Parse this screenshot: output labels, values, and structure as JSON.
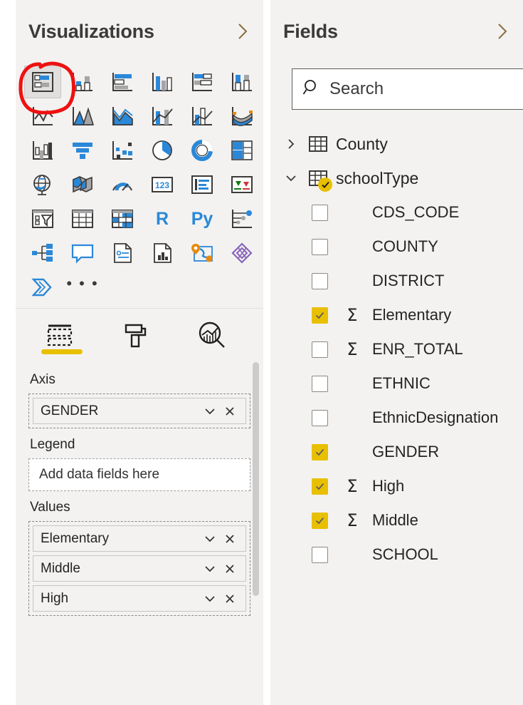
{
  "visualizations": {
    "title": "Visualizations",
    "collapse_icon": "chevron-right-icon",
    "icons": [
      {
        "name": "stacked-bar-chart-icon",
        "selected": true
      },
      {
        "name": "stacked-column-chart-icon",
        "selected": false
      },
      {
        "name": "clustered-bar-chart-icon",
        "selected": false
      },
      {
        "name": "clustered-column-chart-icon",
        "selected": false
      },
      {
        "name": "100-percent-stacked-bar-chart-icon",
        "selected": false
      },
      {
        "name": "100-percent-stacked-column-chart-icon",
        "selected": false
      },
      {
        "name": "line-chart-icon",
        "selected": false
      },
      {
        "name": "area-chart-icon",
        "selected": false
      },
      {
        "name": "stacked-area-chart-icon",
        "selected": false
      },
      {
        "name": "line-and-stacked-column-chart-icon",
        "selected": false
      },
      {
        "name": "line-and-clustered-column-chart-icon",
        "selected": false
      },
      {
        "name": "ribbon-chart-icon",
        "selected": false
      },
      {
        "name": "waterfall-chart-icon",
        "selected": false
      },
      {
        "name": "funnel-chart-icon",
        "selected": false
      },
      {
        "name": "scatter-chart-icon",
        "selected": false
      },
      {
        "name": "pie-chart-icon",
        "selected": false
      },
      {
        "name": "donut-chart-icon",
        "selected": false
      },
      {
        "name": "treemap-icon",
        "selected": false
      },
      {
        "name": "map-icon",
        "selected": false
      },
      {
        "name": "filled-map-icon",
        "selected": false
      },
      {
        "name": "gauge-icon",
        "selected": false
      },
      {
        "name": "card-icon",
        "selected": false
      },
      {
        "name": "multi-row-card-icon",
        "selected": false
      },
      {
        "name": "kpi-icon",
        "selected": false
      },
      {
        "name": "slicer-icon",
        "selected": false
      },
      {
        "name": "table-icon",
        "selected": false
      },
      {
        "name": "matrix-icon",
        "selected": false
      },
      {
        "name": "r-script-visual-icon",
        "selected": false,
        "text": "R"
      },
      {
        "name": "python-visual-icon",
        "selected": false,
        "text": "Py"
      },
      {
        "name": "key-influencers-icon",
        "selected": false
      },
      {
        "name": "decomposition-tree-icon",
        "selected": false
      },
      {
        "name": "q-and-a-icon",
        "selected": false
      },
      {
        "name": "smart-narrative-icon",
        "selected": false
      },
      {
        "name": "paginated-report-icon",
        "selected": false
      },
      {
        "name": "arcgis-maps-icon",
        "selected": false
      },
      {
        "name": "power-apps-icon",
        "selected": false
      },
      {
        "name": "power-automate-icon",
        "selected": false
      },
      {
        "name": "more-options-icon",
        "selected": false,
        "text": "• • •"
      }
    ],
    "tabs": [
      {
        "name": "tab-fields",
        "icon": "fields-dashed-table-icon",
        "active": true
      },
      {
        "name": "tab-format",
        "icon": "paint-roller-icon",
        "active": false
      },
      {
        "name": "tab-analytics",
        "icon": "analytics-magnifier-icon",
        "active": false
      }
    ],
    "wells": [
      {
        "label": "Axis",
        "empty": false,
        "fields": [
          {
            "name": "GENDER",
            "dropdown_icon": "chevron-down-icon",
            "remove_icon": "close-icon"
          }
        ]
      },
      {
        "label": "Legend",
        "empty": true,
        "placeholder": "Add data fields here",
        "fields": []
      },
      {
        "label": "Values",
        "empty": false,
        "fields": [
          {
            "name": "Elementary",
            "dropdown_icon": "chevron-down-icon",
            "remove_icon": "close-icon"
          },
          {
            "name": "Middle",
            "dropdown_icon": "chevron-down-icon",
            "remove_icon": "close-icon"
          },
          {
            "name": "High",
            "dropdown_icon": "chevron-down-icon",
            "remove_icon": "close-icon"
          }
        ]
      }
    ]
  },
  "fields": {
    "title": "Fields",
    "collapse_icon": "chevron-right-icon",
    "search": {
      "value": "",
      "placeholder": "Search",
      "icon": "search-icon"
    },
    "tables": [
      {
        "name": "County",
        "expanded": false,
        "expander_icon": "chevron-right-icon",
        "table_icon": "table-icon",
        "badge": false,
        "columns": []
      },
      {
        "name": "schoolType",
        "expanded": true,
        "expander_icon": "chevron-down-icon",
        "table_icon": "table-icon",
        "badge": true,
        "badge_icon": "check-icon",
        "columns": [
          {
            "name": "CDS_CODE",
            "checked": false,
            "measure": false
          },
          {
            "name": "COUNTY",
            "checked": false,
            "measure": false
          },
          {
            "name": "DISTRICT",
            "checked": false,
            "measure": false
          },
          {
            "name": "Elementary",
            "checked": true,
            "measure": true
          },
          {
            "name": "ENR_TOTAL",
            "checked": false,
            "measure": true
          },
          {
            "name": "ETHNIC",
            "checked": false,
            "measure": false
          },
          {
            "name": "EthnicDesignation",
            "checked": false,
            "measure": false
          },
          {
            "name": "GENDER",
            "checked": true,
            "measure": false
          },
          {
            "name": "High",
            "checked": true,
            "measure": true
          },
          {
            "name": "Middle",
            "checked": true,
            "measure": true
          },
          {
            "name": "SCHOOL",
            "checked": false,
            "measure": false
          }
        ]
      }
    ]
  },
  "annotation": {
    "name": "red-hand-drawn-circle",
    "color": "#ee1111",
    "targets": "stacked-bar-chart-icon"
  },
  "colors": {
    "panel_bg": "#f3f2f1",
    "accent_yellow": "#e8c000",
    "icon_blue": "#2b88d8",
    "icon_gray": "#a6a6a6",
    "text": "#252423"
  }
}
